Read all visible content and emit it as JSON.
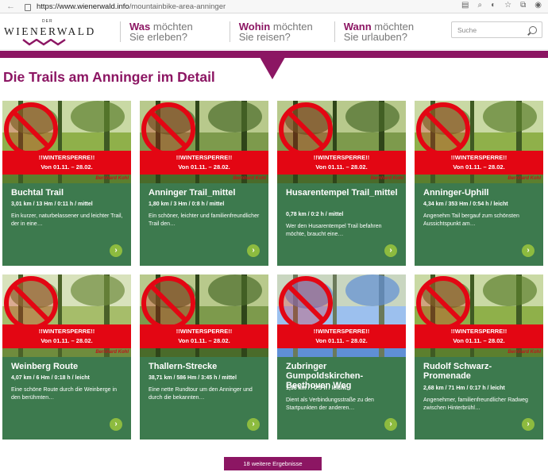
{
  "browser": {
    "url_host": "https://www.wienerwald.info",
    "url_path": "/mountainbike-area-anninger",
    "icons": [
      "reader-view-icon",
      "zoom-icon",
      "tracking-icon",
      "star-icon",
      "collections-icon",
      "profile-icon"
    ]
  },
  "logo": {
    "prefix": "DER",
    "main": "WIENERWALD"
  },
  "nav": [
    {
      "bold": "Was",
      "rest": "möchten",
      "line2": "Sie erleben?"
    },
    {
      "bold": "Wohin",
      "rest": "möchten",
      "line2": "Sie reisen?"
    },
    {
      "bold": "Wann",
      "rest": "möchten",
      "line2": "Sie urlauben?"
    }
  ],
  "search": {
    "placeholder": "Suche"
  },
  "page_title": "Die Trails am Anninger im Detail",
  "cards": [
    {
      "title": "Buchtal Trail",
      "stats": "3,01 km / 13 Hm / 0:11 h / mittel",
      "desc": "Ein kurzer, naturbelassener und leichter Trail, der in eine…",
      "banner1": "!!WINTERSPERRE!!",
      "banner2": "Von 01.11. – 28.02.",
      "sponsor": "Bernhard Kohl",
      "scene": "forest"
    },
    {
      "title": "Anninger Trail_mittel",
      "stats": "1,80 km / 3 Hm / 0:8 h / mittel",
      "desc": "Ein schöner, leichter und familienfreundlicher Trail den…",
      "banner1": "!!WINTERSPERRE!!",
      "banner2": "Von 01.11. – 28.02.",
      "sponsor": "Bernhard Kohl",
      "scene": "woods"
    },
    {
      "title": "Husarentempel Trail_mittel",
      "stats": "0,78 km / 0:2 h / mittel",
      "desc": "Wer den Husarentempel Trail befahren möchte, braucht eine…",
      "banner1": "!!WINTERSPERRE!!",
      "banner2": "Von 01.11. – 28.02.",
      "sponsor": "Bernhard Kohl",
      "scene": "woods"
    },
    {
      "title": "Anninger-Uphill",
      "stats": "4,34 km / 353 Hm / 0:54 h / leicht",
      "desc": "Angenehm Tail bergauf zum schönsten Aussichtspunkt am…",
      "banner1": "!!WINTERSPERRE!!",
      "banner2": "Von 01.11. – 28.02.",
      "sponsor": "Bernhard Kohl",
      "scene": "forest"
    },
    {
      "title": "Weinberg Route",
      "stats": "4,07 km / 6 Hm / 0:18 h / leicht",
      "desc": "Eine schöne Route durch die Weinberge in den berühmten…",
      "banner1": "!!WINTERSPERRE!!",
      "banner2": "Von 01.11. – 28.02.",
      "sponsor": "Bernhard Kohl",
      "scene": "vineyard"
    },
    {
      "title": "Thallern-Strecke",
      "stats": "38,71 km / 586 Hm / 3:45 h / mittel",
      "desc": "Eine nette Rundtour um den Anninger und durch die bekannten…",
      "banner1": "!!WINTERSPERRE!!",
      "banner2": "Von 01.11. – 28.02.",
      "sponsor": "",
      "scene": "woods"
    },
    {
      "title": "Zubringer Gumpoldskirchen-Beethoven Weg",
      "stats": "1,36 km / / 0:5 h / leicht",
      "desc": "Dient als Verbindungsstraße zu den Startpunkten der anderen…",
      "banner1": "!!WINTERSPERRE!!",
      "banner2": "Von 01.11. – 28.02.",
      "sponsor": "",
      "scene": "sky"
    },
    {
      "title": "Rudolf Schwarz-Promenade",
      "stats": "2,68 km / 71 Hm / 0:17 h / leicht",
      "desc": "Angenehmer, familienfreundlicher Radweg zwischen Hinterbrühl…",
      "banner1": "!!WINTERSPERRE!!",
      "banner2": "Von 01.11. – 28.02.",
      "sponsor": "Bernhard Kohl",
      "scene": "forest"
    }
  ],
  "more_button": "18 weitere Ergebnisse",
  "colors": {
    "brand": "#8c1663",
    "card_bg": "#3d7a4e",
    "banner": "#e30613",
    "arrow": "#8dbb3f"
  }
}
